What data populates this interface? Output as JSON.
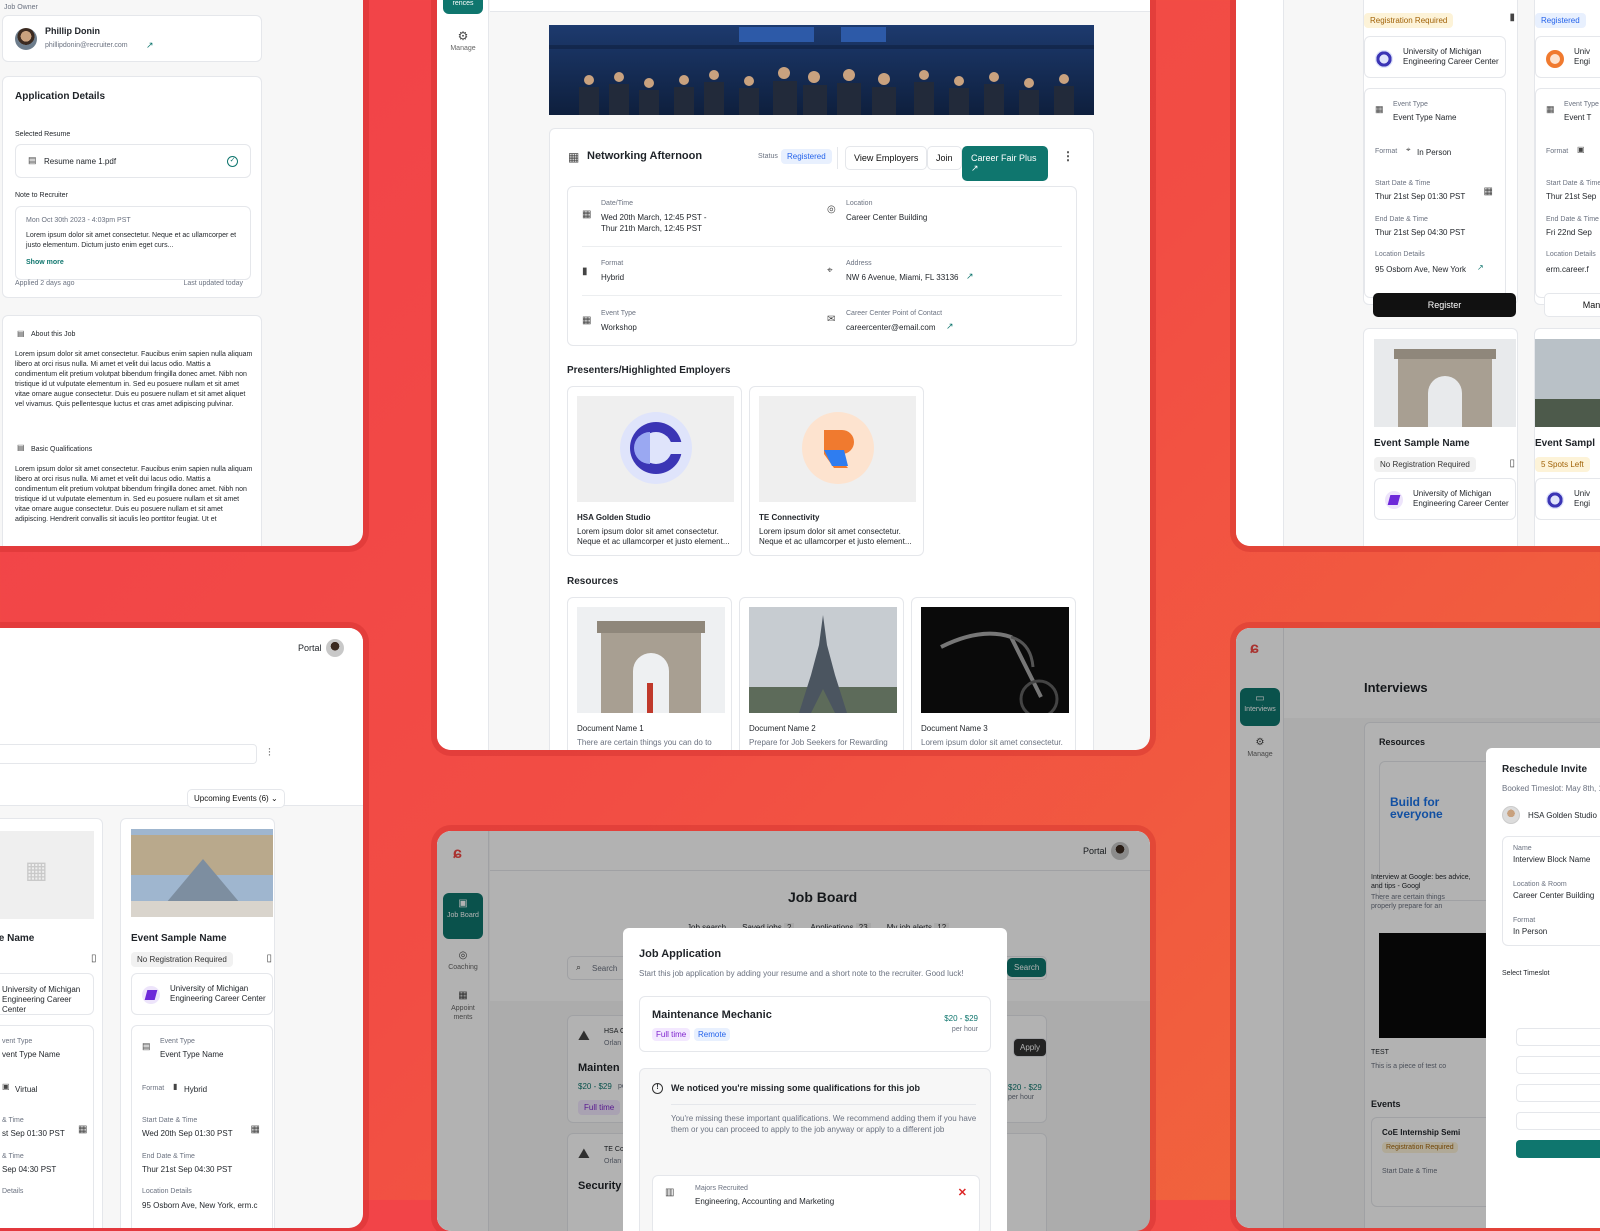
{
  "tl": {
    "job_owner_label": "Job Owner",
    "owner_name": "Phillip Donin",
    "owner_email": "phillipdonin@recruiter.com",
    "app_details_title": "Application Details",
    "selected_resume_label": "Selected Resume",
    "resume_name": "Resume name 1.pdf",
    "note_label": "Note to Recruiter",
    "note_date": "Mon Oct 30th 2023 - 4:03pm PST",
    "note_text": "Lorem ipsum dolor sit amet consectetur. Neque et ac ullamcorper et justo elementum. Dictum justo enim eget curs...",
    "show_more": "Show more",
    "applied": "Applied 2 days ago",
    "updated": "Last updated today",
    "about_label": "About this Job",
    "about_text": "Lorem ipsum dolor sit amet consectetur. Faucibus enim sapien nulla aliquam libero at orci risus nulla. Mi amet et velit dui lacus odio. Mattis a condimentum elit pretium volutpat bibendum fringilla donec amet. Nibh non tristique id ut vulputate elementum in. Sed eu posuere nullam et sit amet vitae ornare augue consectetur. Duis eu posuere nullam et sit amet aliquet vel vivamus. Quis pellentesque luctus et cras amet adipiscing pulvinar.",
    "basic_label": "Basic Qualifications",
    "basic_text": "Lorem ipsum dolor sit amet consectetur. Faucibus enim sapien nulla aliquam libero at orci risus nulla. Mi amet et velit dui lacus odio. Mattis a condimentum elit pretium volutpat bibendum fringilla donec amet. Nibh non tristique id ut vulputate elementum in. Sed eu posuere nullam et sit amet vitae ornare augue consectetur. Duis eu posuere nullam et sit amet adipiscing. Hendrerit convallis sit iaculis leo porttitor feugiat. Ut et"
  },
  "tc": {
    "nav_tab": "rences",
    "manage": "Manage",
    "event_title": "Networking Afternoon",
    "status_label": "Status",
    "status_value": "Registered",
    "view_employers": "View Employers",
    "join": "Join",
    "career_fair": "Career Fair Plus",
    "date_label": "Date/Time",
    "date_value1": "Wed 20th March, 12:45 PST -",
    "date_value2": "Thur 21th March, 12:45 PST",
    "location_label": "Location",
    "location_value": "Career Center Building",
    "format_label": "Format",
    "format_value": "Hybrid",
    "address_label": "Address",
    "address_value": "NW 6 Avenue, Miami, FL 33136",
    "type_label": "Event Type",
    "type_value": "Workshop",
    "poc_label": "Career Center Point of Contact",
    "poc_value": "careercenter@email.com",
    "presenters_title": "Presenters/Highlighted Employers",
    "employers": [
      {
        "name": "HSA Golden Studio",
        "desc": "Lorem ipsum dolor sit amet consectetur. Neque et ac ullamcorper et justo element..."
      },
      {
        "name": "TE Connectivity",
        "desc": "Lorem ipsum dolor sit amet consectetur. Neque et ac ullamcorper et justo element..."
      }
    ],
    "resources_title": "Resources",
    "documents": [
      {
        "name": "Document Name 1",
        "desc": "There are certain things you can do to"
      },
      {
        "name": "Document Name 2",
        "desc": "Prepare for Job Seekers for Rewarding"
      },
      {
        "name": "Document Name 3",
        "desc": "Lorem ipsum dolor sit amet consectetur."
      }
    ]
  },
  "tr": {
    "reg_required": "Registration Required",
    "registered": "Registered",
    "org": "University of Michigan Engineering Career Center",
    "org_cut": "Univ Engi",
    "type_label": "Event Type",
    "type_value": "Event Type Name",
    "type_cut": "Event T",
    "format_label": "Format",
    "format_value": "In Person",
    "start_label": "Start Date & Time",
    "start_value": "Thur 21st Sep 01:30 PST",
    "start_cut": "Thur 21st Sep",
    "end_label": "End Date & Time",
    "end_value": "Thur 21st Sep 04:30 PST",
    "end_cut": "Fri 22nd Sep",
    "locdet_label": "Location Details",
    "locdet_value": "95 Osborn Ave, New York",
    "locdet_cut": "erm.career.f",
    "register": "Register",
    "manage_cut": "Mana",
    "event_name": "Event Sample Name",
    "event_name_cut": "Event Sampl",
    "no_reg": "No Registration Required",
    "spots_left": "5 Spots Left",
    "org2": "University of Michigan Engineering Career Center",
    "org2_cut": "Univ Engi"
  },
  "bl": {
    "portal": "Portal",
    "upcoming": "Upcoming Events (6)",
    "event_name_cut": "mple Name",
    "event_name": "Event Sample Name",
    "no_reg": "No Registration Required",
    "org_cut": "University of Michigan Engineering Career Center",
    "org": "University of Michigan Engineering Career Center",
    "type_label_cut": "vent Type",
    "type_value_cut": "vent Type Name",
    "type_label": "Event Type",
    "type_value": "Event Type Name",
    "virtual": "Virtual",
    "format_label": "Format",
    "hybrid": "Hybrid",
    "start_label_cut": "& Time",
    "start_cut": "st Sep 01:30 PST",
    "start_label": "Start Date & Time",
    "start_value": "Wed 20th Sep 01:30 PST",
    "end_label_cut": "& Time",
    "end_cut": "Sep 04:30 PST",
    "end_label": "End Date & Time",
    "end_value": "Thur 21st Sep 04:30 PST",
    "locdet_cut": "Details",
    "locdet_label": "Location Details",
    "locdet_value": "95 Osborn Ave, New York, erm.c"
  },
  "bc": {
    "portal": "Portal",
    "nav": [
      {
        "label": "Job Board"
      },
      {
        "label": "Coaching"
      },
      {
        "label": "Appoint ments"
      }
    ],
    "page_title": "Job Board",
    "tabs": [
      "Job search",
      "Saved jobs",
      "Applications",
      "My job alerts"
    ],
    "tab_counts": [
      "",
      "2",
      "23",
      "12"
    ],
    "search_placeholder": "Search",
    "search_button": "Search",
    "bg_company": "HSA G",
    "bg_company_sub": "Orlan",
    "bg_job": "Mainten",
    "bg_pay": "$20 - $29",
    "bg_pay_unit": "per",
    "bg_full": "Full time",
    "bg_apply": "Apply",
    "bg_pay_right": "$20 - $29",
    "bg_pay_right_unit": "per hour",
    "bg_company2": "TE Co",
    "bg_company2_sub": "Orlan",
    "bg_job2": "Security",
    "modal_title": "Job Application",
    "modal_sub": "Start this job application by adding your resume and a short note to the recruiter. Good luck!",
    "job_title": "Maintenance Mechanic",
    "job_pay": "$20 - $29",
    "job_pay_unit": "per hour",
    "job_tag1": "Full time",
    "job_tag2": "Remote",
    "warn_title": "We noticed you're missing some qualifications for this job",
    "warn_text": "You're missing these important qualifications. We recommend adding them if you have them or you can proceed to apply to the job anyway or apply to a different job",
    "majors_label": "Majors Recruited",
    "majors_value": "Engineering, Accounting and Marketing"
  },
  "br": {
    "nav_label": "Interviews",
    "manage": "Manage",
    "page_title": "Interviews",
    "resources": "Resources",
    "build_text": "Build for everyone",
    "res_caption": "Interview at Google: bes advice, and tips - Googl",
    "res_caption2": "There are certain things properly prepare for an",
    "test_label": "TEST",
    "test_desc": "This is a piece of test co",
    "events_label": "Events",
    "event_name": "CoE Internship Semi",
    "reg_required": "Registration Required",
    "start_label": "Start Date & Time",
    "modal_title": "Reschedule Invite",
    "booked": "Booked Timeslot: May 8th, 12",
    "company": "HSA Golden Studio",
    "name_label": "Name",
    "name_value": "Interview Block Name",
    "loc_label": "Location & Room",
    "loc_value": "Career Center Building",
    "format_label": "Format",
    "format_value": "In Person",
    "select_timeslot": "Select Timeslot",
    "date_cut": "8th",
    "time_cut": "Ti"
  },
  "colors": {
    "accent": "#0f766e",
    "brand": "#f24a45",
    "blue": "#2563eb"
  }
}
